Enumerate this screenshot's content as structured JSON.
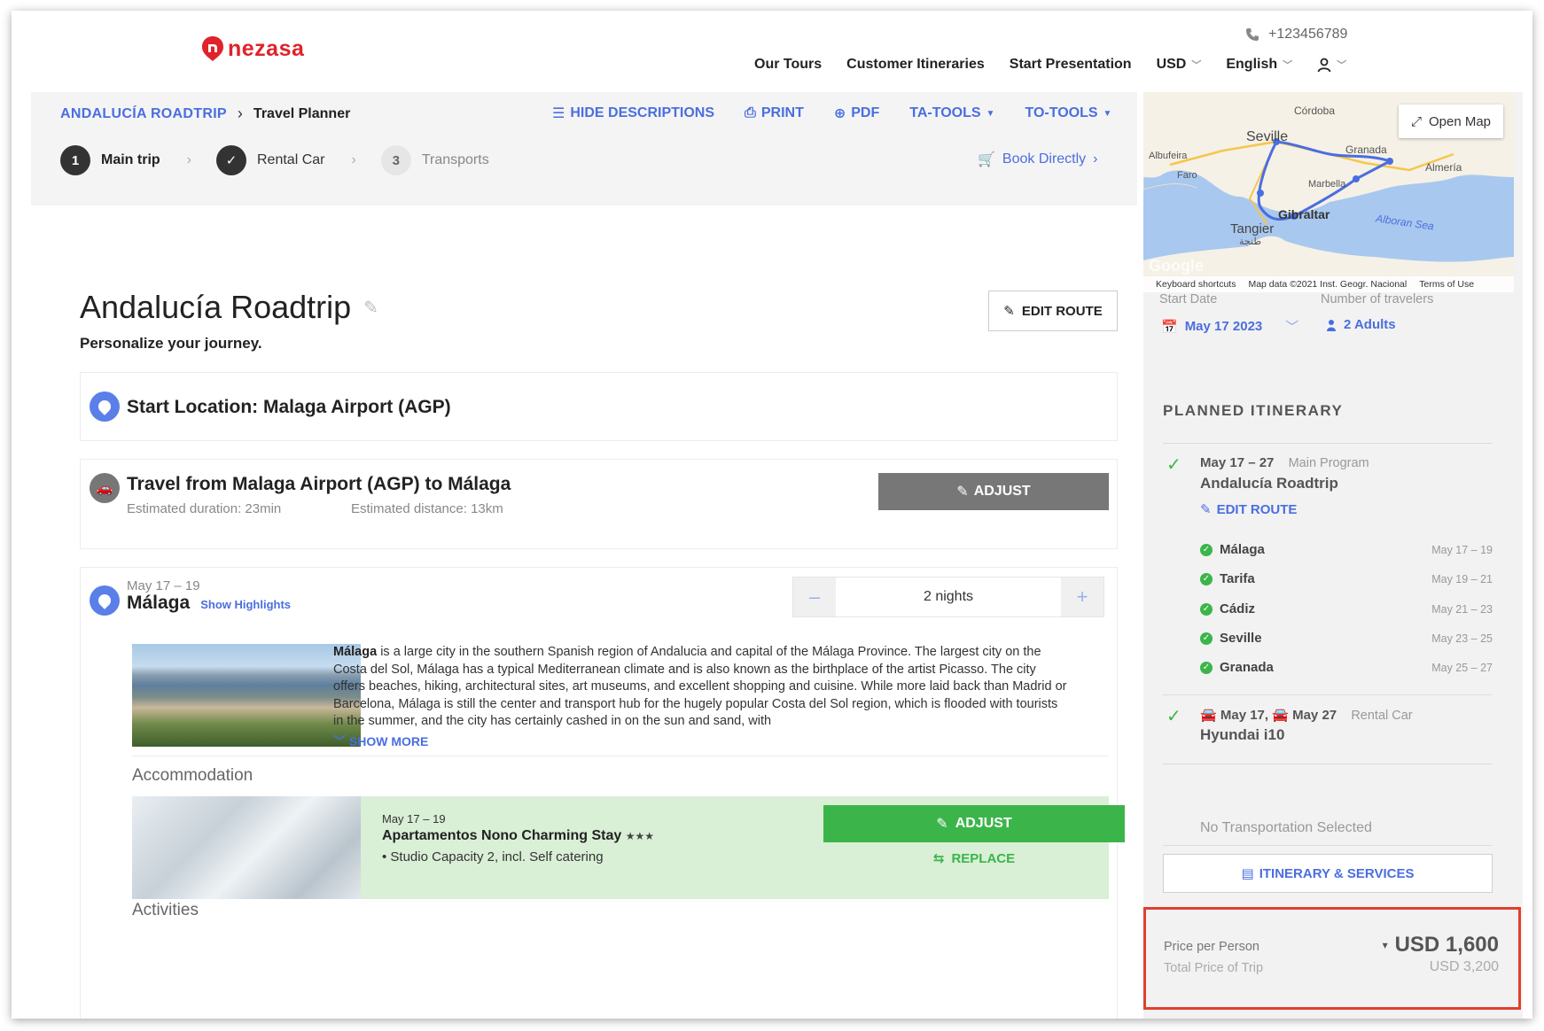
{
  "header": {
    "brand": "nezasa",
    "phone": "+123456789",
    "nav": [
      "Our Tours",
      "Customer Itineraries",
      "Start Presentation"
    ],
    "currency": "USD",
    "language": "English"
  },
  "toolbar": {
    "breadcrumb_root": "ANDALUCÍA ROADTRIP",
    "breadcrumb_current": "Travel Planner",
    "hide_descriptions": "HIDE DESCRIPTIONS",
    "print": "PRINT",
    "pdf": "PDF",
    "ta_tools": "TA-TOOLS",
    "to_tools": "TO-TOOLS",
    "steps": [
      {
        "num": "1",
        "label": "Main trip"
      },
      {
        "num": "",
        "label": "Rental Car"
      },
      {
        "num": "3",
        "label": "Transports"
      }
    ],
    "book_directly": "Book Directly"
  },
  "trip": {
    "title": "Andalucía Roadtrip",
    "subtitle": "Personalize your journey.",
    "edit_route": "EDIT ROUTE"
  },
  "start": {
    "title": "Start Location: Malaga Airport (AGP)"
  },
  "travel": {
    "title": "Travel from Malaga Airport (AGP) to Málaga",
    "duration": "Estimated duration: 23min",
    "distance": "Estimated distance: 13km",
    "adjust": "ADJUST"
  },
  "stop": {
    "dates": "May 17 – 19",
    "name": "Málaga",
    "highlights": "Show Highlights",
    "nights": "2 nights",
    "minus": "–",
    "plus": "+",
    "desc_bold": "Málaga",
    "description": " is a large city in the southern Spanish region of Andalucia and capital of the Málaga Province. The largest city on the Costa del Sol, Málaga has a typical Mediterranean climate and is also known as the birthplace of the artist Picasso. The city offers beaches, hiking, architectural sites, art museums, and excellent shopping and cuisine. While more laid back than Madrid or Barcelona, Málaga is still the center and transport hub for the hugely popular Costa del Sol region, which is flooded with tourists in the summer, and the city has certainly cashed in on the sun and sand, with",
    "show_more": "SHOW MORE",
    "accommodation_label": "Accommodation",
    "activities_label": "Activities",
    "accom_dates": "May 17 – 19",
    "accom_name": "Apartamentos Nono Charming Stay",
    "accom_stars": "★★★",
    "accom_feature": "• Studio Capacity 2, incl. Self catering",
    "accom_adjust": "ADJUST",
    "accom_replace": "REPLACE"
  },
  "map": {
    "open_map": "Open Map",
    "cities": [
      "Córdoba",
      "Seville",
      "Granada",
      "Almería",
      "Albufeira",
      "Faro",
      "Marbella",
      "Gibraltar",
      "Tangier",
      "طنجة",
      "Alboran Sea",
      "Google"
    ],
    "footer": [
      "Keyboard shortcuts",
      "Map data ©2021 Inst. Geogr. Nacional",
      "Terms of Use"
    ]
  },
  "sidebar": {
    "start_date_label": "Start Date",
    "start_date": "May 17 2023",
    "travelers_label": "Number of travelers",
    "travelers": "2 Adults",
    "planned_title": "PLANNED ITINERARY",
    "main_dates": "May 17 – 27",
    "main_type": "Main Program",
    "main_title": "Andalucía Roadtrip",
    "edit_route": "EDIT ROUTE",
    "stops": [
      {
        "name": "Málaga",
        "dates": "May 17 – 19"
      },
      {
        "name": "Tarifa",
        "dates": "May 19 – 21"
      },
      {
        "name": "Cádiz",
        "dates": "May 21 – 23"
      },
      {
        "name": "Seville",
        "dates": "May 23 – 25"
      },
      {
        "name": "Granada",
        "dates": "May 25 – 27"
      }
    ],
    "car_dates_a": "May 17,",
    "car_dates_b": "May 27",
    "car_type": "Rental Car",
    "car_name": "Hyundai i10",
    "no_transport": "No Transportation Selected",
    "itinerary_services": "ITINERARY & SERVICES",
    "price_per_person_label": "Price per Person",
    "price_per_person": "USD 1,600",
    "total_label": "Total Price of Trip",
    "total": "USD 3,200"
  },
  "colors": {
    "accent": "#4a6ee0",
    "brand": "#e0222a",
    "green": "#3bb54a",
    "highlight": "#e0402e"
  }
}
